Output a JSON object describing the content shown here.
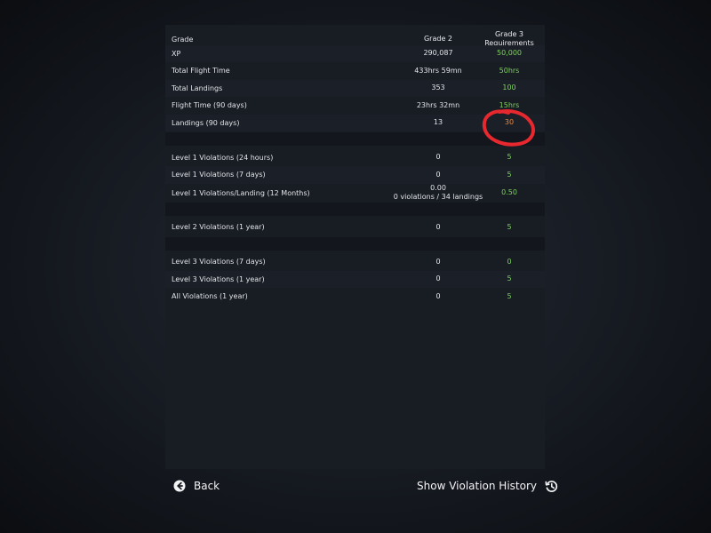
{
  "table": {
    "header": {
      "label": "Grade",
      "current": "Grade 2",
      "requirement_line1": "Grade 3",
      "requirement_line2": "Requirements"
    },
    "rows": [
      {
        "label": "XP",
        "value": "290,087",
        "requirement": "50,000",
        "status": "ok"
      },
      {
        "label": "Total Flight Time",
        "value": "433hrs 59mn",
        "requirement": "50hrs",
        "status": "ok"
      },
      {
        "label": "Total Landings",
        "value": "353",
        "requirement": "100",
        "status": "ok"
      },
      {
        "label": "Flight Time (90 days)",
        "value": "23hrs 32mn",
        "requirement": "15hrs",
        "status": "ok"
      },
      {
        "label": "Landings (90 days)",
        "value": "13",
        "requirement": "30",
        "status": "bad"
      },
      {
        "label": "Level 1 Violations (24 hours)",
        "value": "0",
        "requirement": "5",
        "status": "ok"
      },
      {
        "label": "Level 1 Violations (7 days)",
        "value": "0",
        "requirement": "5",
        "status": "ok"
      },
      {
        "label": "Level 1 Violations/Landing (12 Months)",
        "value": "0.00",
        "value_sub": "0 violations / 34 landings",
        "requirement": "0.50",
        "status": "ok"
      },
      {
        "label": "Level 2 Violations (1 year)",
        "value": "0",
        "requirement": "5",
        "status": "ok"
      },
      {
        "label": "Level 3 Violations (7 days)",
        "value": "0",
        "requirement": "0",
        "status": "ok"
      },
      {
        "label": "Level 3 Violations (1 year)",
        "value": "0",
        "requirement": "5",
        "status": "ok"
      },
      {
        "label": "All Violations (1 year)",
        "value": "0",
        "requirement": "5",
        "status": "ok"
      }
    ]
  },
  "footer": {
    "back_label": "Back",
    "back_icon": "arrow-left-circle-icon",
    "history_label": "Show Violation History",
    "history_icon": "history-icon"
  },
  "colors": {
    "ok": "#7fd35f",
    "bad": "#ee8a3a",
    "annotation": "#e8282f"
  }
}
